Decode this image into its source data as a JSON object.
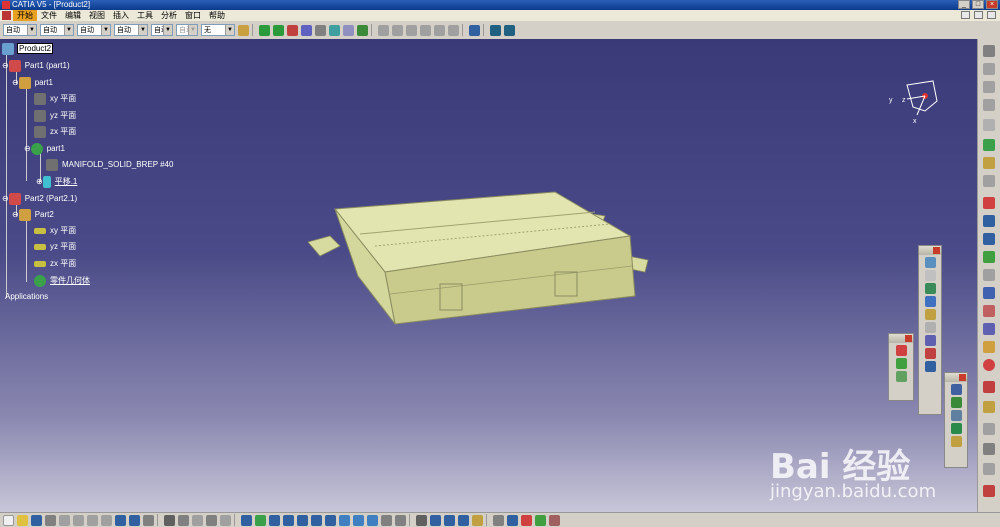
{
  "window": {
    "title": "CATIA V5 - [Product2]"
  },
  "menu": {
    "items": [
      "开始",
      "文件",
      "编辑",
      "视图",
      "插入",
      "工具",
      "分析",
      "窗口",
      "帮助"
    ],
    "active_index": 0
  },
  "toolbar": {
    "combos": [
      "自动",
      "自动",
      "自动",
      "自动",
      "自动",
      "自动",
      "无"
    ]
  },
  "tree": {
    "root": "Product2",
    "part1_instance": "Part1 (part1)",
    "part1": "part1",
    "part1_xy": "xy 平面",
    "part1_yz": "yz 平面",
    "part1_zx": "zx 平面",
    "part1_body": "part1",
    "manifold": "MANIFOLD_SOLID_BREP #40",
    "plane1": "平移.1",
    "part2_instance": "Part2 (Part2.1)",
    "part2": "Part2",
    "part2_xy": "xy 平面",
    "part2_yz": "yz 平面",
    "part2_zx": "zx 平面",
    "part2_body": "零件几何体",
    "applications": "Applications"
  },
  "compass": {
    "axis_x": "x",
    "axis_y": "y",
    "axis_z": "z"
  },
  "watermark": {
    "brand": "Bai 经验",
    "url": "jingyan.baidu.com"
  },
  "colors": {
    "model": "#d8dba0",
    "viewport_top": "#3a3a78",
    "viewport_bottom": "#c8c6d8",
    "selection": "#ffffff"
  }
}
